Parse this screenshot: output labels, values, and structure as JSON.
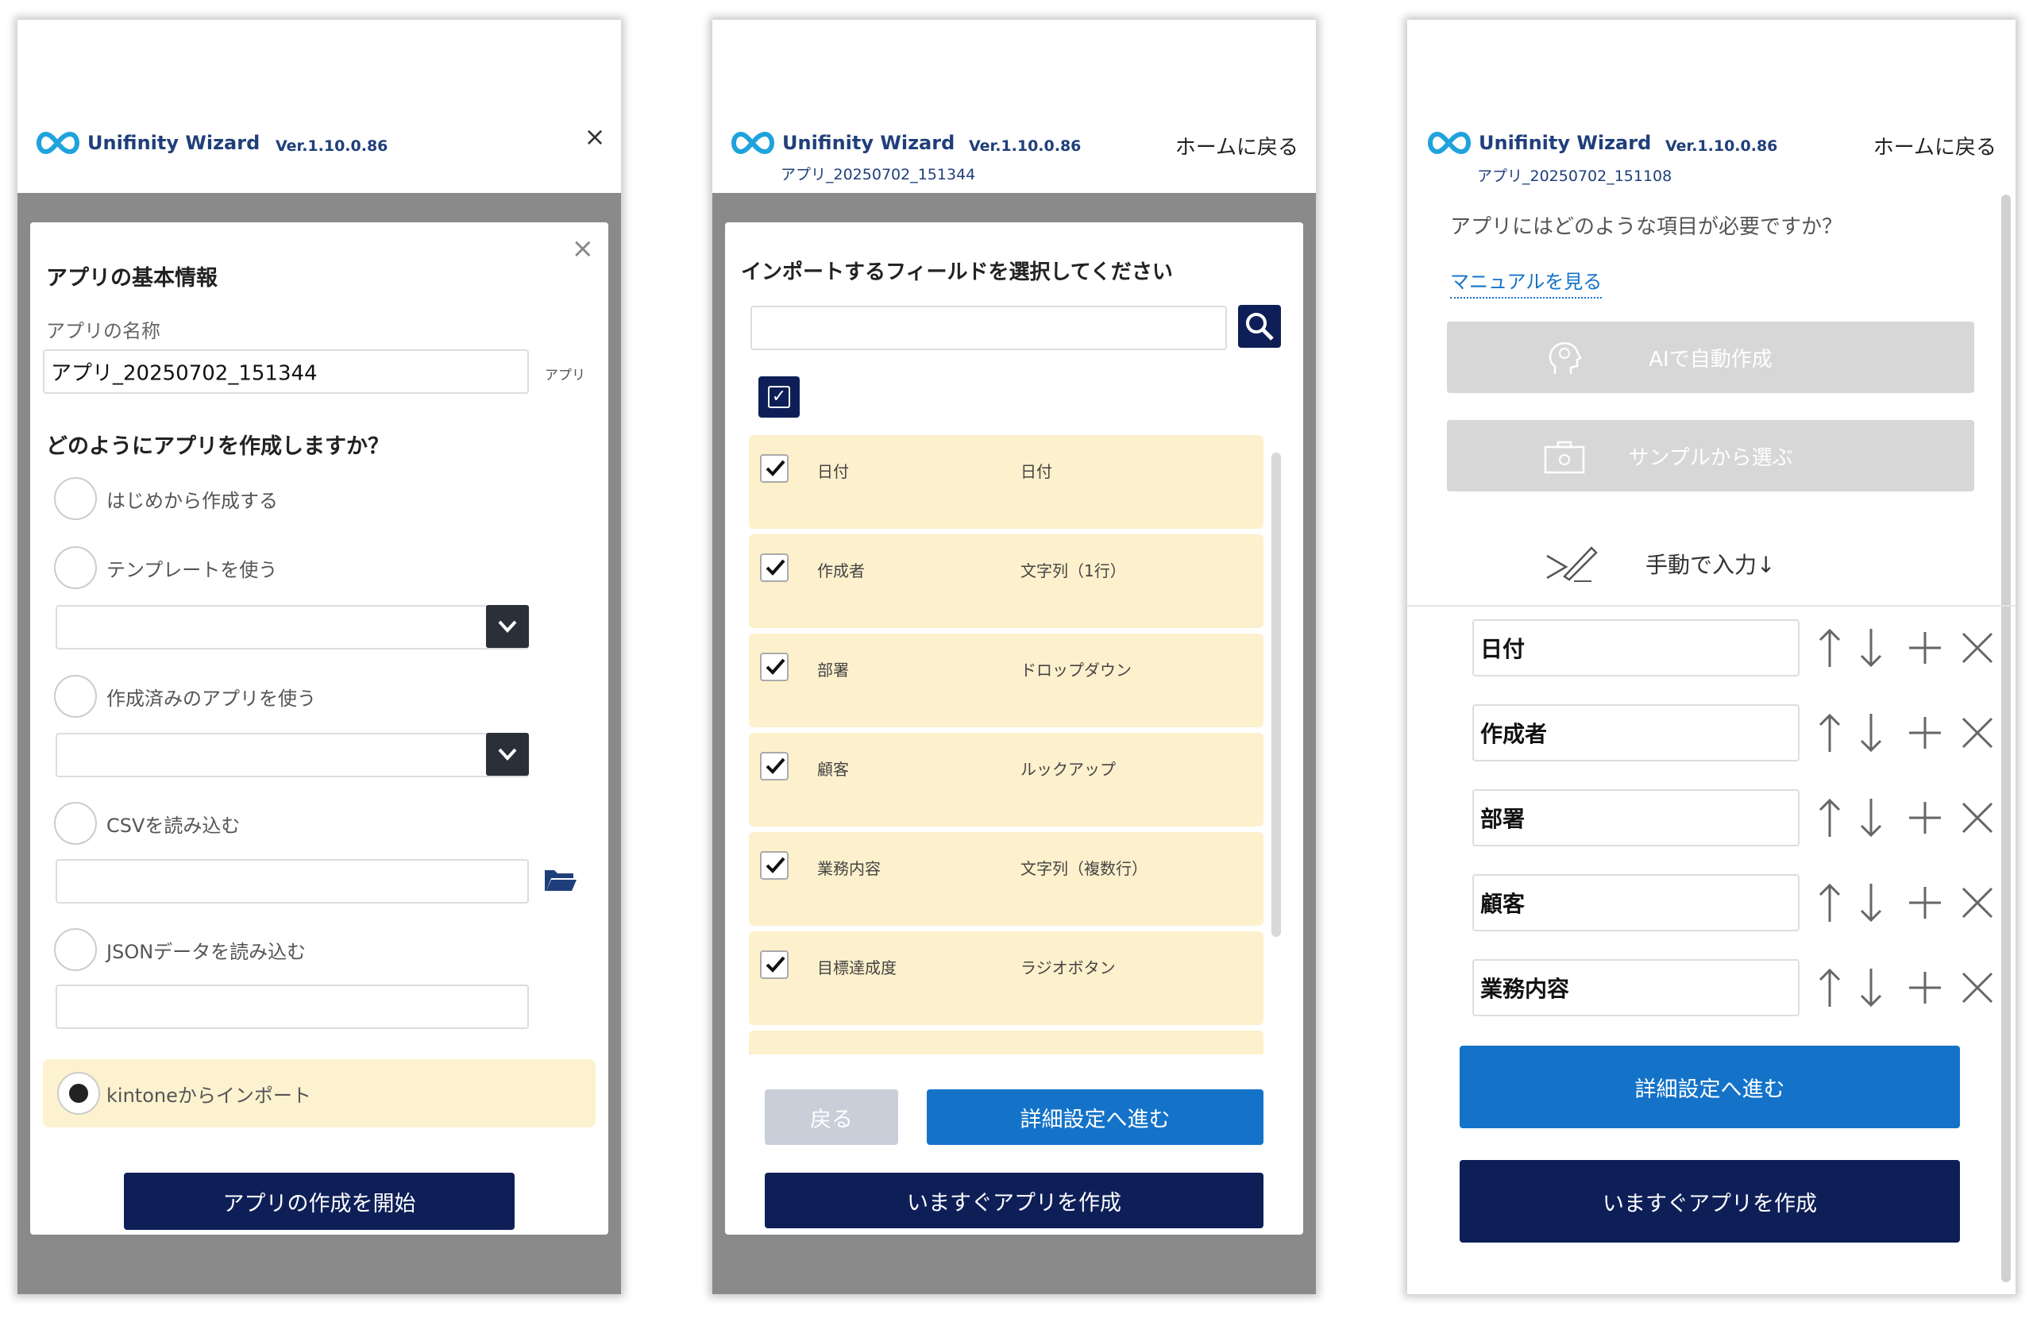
{
  "common": {
    "brand": "Unifinity Wizard",
    "version": "Ver.1.10.0.86",
    "home_link": "ホームに戻る"
  },
  "panel1": {
    "title": "アプリの基本情報",
    "name_label": "アプリの名称",
    "name_value": "アプリ_20250702_151344",
    "name_suffix": "アプリ",
    "how_title": "どのようにアプリを作成しますか？",
    "options": [
      {
        "label": "はじめから作成する",
        "selected": false
      },
      {
        "label": "テンプレートを使う",
        "selected": false
      },
      {
        "label": "作成済みのアプリを使う",
        "selected": false
      },
      {
        "label": "CSVを読み込む",
        "selected": false
      },
      {
        "label": "JSONデータを読み込む",
        "selected": false
      },
      {
        "label": "kintoneからインポート",
        "selected": true
      }
    ],
    "start_button": "アプリの作成を開始"
  },
  "panel2": {
    "app_name": "アプリ_20250702_151344",
    "title": "インポートするフィールドを選択してください",
    "search_value": "",
    "fields": [
      {
        "name": "日付",
        "type": "日付",
        "checked": true
      },
      {
        "name": "作成者",
        "type": "文字列（1行）",
        "checked": true
      },
      {
        "name": "部署",
        "type": "ドロップダウン",
        "checked": true
      },
      {
        "name": "顧客",
        "type": "ルックアップ",
        "checked": true
      },
      {
        "name": "業務内容",
        "type": "文字列（複数行）",
        "checked": true
      },
      {
        "name": "目標達成度",
        "type": "ラジオボタン",
        "checked": true
      }
    ],
    "back_button": "戻る",
    "next_button": "詳細設定へ進む",
    "create_button": "いますぐアプリを作成"
  },
  "panel3": {
    "app_name": "アプリ_20250702_151108",
    "question": "アプリにはどのような項目が必要ですか？",
    "manual_link": "マニュアルを見る",
    "ai_button": "AIで自動作成",
    "sample_button": "サンプルから選ぶ",
    "manual_input": "手動で入力↓",
    "items": [
      "日付",
      "作成者",
      "部署",
      "顧客",
      "業務内容"
    ],
    "next_button": "詳細設定へ進む",
    "create_button": "いますぐアプリを作成"
  },
  "colors": {
    "navy": "#0e1f58",
    "blue": "#1473c9",
    "highlight": "#fdf2cf",
    "brand_text": "#1f3f7a"
  }
}
